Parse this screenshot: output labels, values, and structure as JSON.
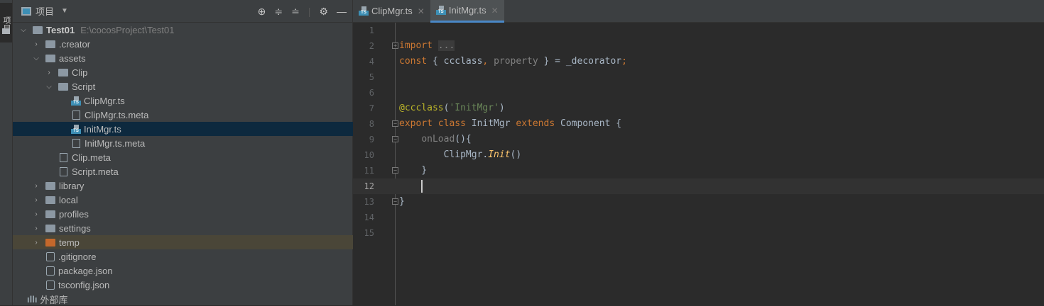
{
  "sidebar_strip": {
    "label": "项目"
  },
  "project": {
    "title": "项目",
    "tree": [
      {
        "label": "Test01",
        "path": "E:\\cocosProject\\Test01",
        "level": 0,
        "kind": "folder",
        "expanded": true,
        "bold": true
      },
      {
        "label": ".creator",
        "level": 1,
        "kind": "folder",
        "expanded": false
      },
      {
        "label": "assets",
        "level": 1,
        "kind": "folder",
        "expanded": true
      },
      {
        "label": "Clip",
        "level": 2,
        "kind": "folder",
        "expanded": false
      },
      {
        "label": "Script",
        "level": 2,
        "kind": "folder",
        "expanded": true
      },
      {
        "label": "ClipMgr.ts",
        "level": 3,
        "kind": "ts"
      },
      {
        "label": "ClipMgr.ts.meta",
        "level": 3,
        "kind": "file"
      },
      {
        "label": "InitMgr.ts",
        "level": 3,
        "kind": "ts",
        "selected": true
      },
      {
        "label": "InitMgr.ts.meta",
        "level": 3,
        "kind": "file"
      },
      {
        "label": "Clip.meta",
        "level": 2,
        "kind": "file"
      },
      {
        "label": "Script.meta",
        "level": 2,
        "kind": "file"
      },
      {
        "label": "library",
        "level": 1,
        "kind": "folder",
        "expanded": false
      },
      {
        "label": "local",
        "level": 1,
        "kind": "folder",
        "expanded": false
      },
      {
        "label": "profiles",
        "level": 1,
        "kind": "folder",
        "expanded": false
      },
      {
        "label": "settings",
        "level": 1,
        "kind": "folder",
        "expanded": false
      },
      {
        "label": "temp",
        "level": 1,
        "kind": "folder-excluded",
        "expanded": false,
        "highlight": true
      },
      {
        "label": ".gitignore",
        "level": 1,
        "kind": "cfg"
      },
      {
        "label": "package.json",
        "level": 1,
        "kind": "cfg"
      },
      {
        "label": "tsconfig.json",
        "level": 1,
        "kind": "cfg"
      },
      {
        "label": "外部库",
        "level": 0,
        "kind": "lib"
      }
    ]
  },
  "tabs": [
    {
      "label": "ClipMgr.ts",
      "active": false
    },
    {
      "label": "InitMgr.ts",
      "active": true
    }
  ],
  "editor": {
    "current_line": 12,
    "lines": [
      {
        "n": "1",
        "tokens": []
      },
      {
        "n": "2",
        "fold": "+",
        "tokens": [
          {
            "t": "import",
            "c": "kw"
          },
          {
            "t": " "
          },
          {
            "t": "...",
            "c": "fold-txt"
          }
        ]
      },
      {
        "n": "4",
        "tokens": [
          {
            "t": "const",
            "c": "kw"
          },
          {
            "t": " { ccclass"
          },
          {
            "t": ",",
            "c": "kw"
          },
          {
            "t": " property",
            "c": "gray"
          },
          {
            "t": " } = _decorator"
          },
          {
            "t": ";",
            "c": "kw"
          }
        ]
      },
      {
        "n": "5",
        "tokens": []
      },
      {
        "n": "6",
        "tokens": []
      },
      {
        "n": "7",
        "tokens": [
          {
            "t": "@ccclass",
            "c": "dec"
          },
          {
            "t": "("
          },
          {
            "t": "'InitMgr'",
            "c": "str"
          },
          {
            "t": ")"
          }
        ]
      },
      {
        "n": "8",
        "fold": "-",
        "tokens": [
          {
            "t": "export class ",
            "c": "kw"
          },
          {
            "t": "InitMgr "
          },
          {
            "t": "extends ",
            "c": "kw"
          },
          {
            "t": "Component {"
          }
        ]
      },
      {
        "n": "9",
        "fold": "-",
        "tokens": [
          {
            "t": "    "
          },
          {
            "t": "onLoad",
            "c": "gray"
          },
          {
            "t": "(){"
          }
        ]
      },
      {
        "n": "10",
        "tokens": [
          {
            "t": "        ClipMgr."
          },
          {
            "t": "Init",
            "c": "fn"
          },
          {
            "t": "()"
          }
        ]
      },
      {
        "n": "11",
        "fold": "-",
        "tokens": [
          {
            "t": "    }"
          }
        ]
      },
      {
        "n": "12",
        "tokens": []
      },
      {
        "n": "13",
        "fold": "-",
        "tokens": [
          {
            "t": "}"
          }
        ]
      },
      {
        "n": "14",
        "tokens": []
      },
      {
        "n": "15",
        "tokens": []
      }
    ]
  }
}
